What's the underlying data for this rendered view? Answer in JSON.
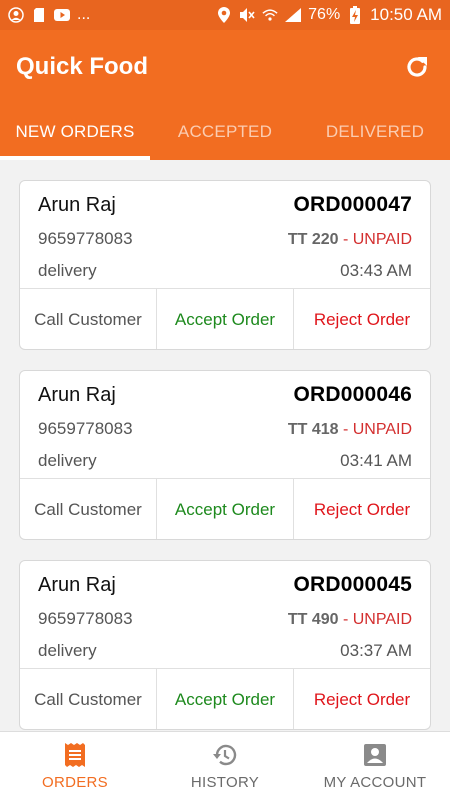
{
  "status_bar": {
    "left_icons": [
      "account-circle-icon",
      "sd-card-icon",
      "youtube-icon"
    ],
    "ellipsis": "...",
    "battery": "76%",
    "time": "10:50 AM"
  },
  "header": {
    "title": "Quick Food",
    "refresh_icon": "refresh-icon"
  },
  "tabs": [
    {
      "label": "NEW ORDERS",
      "active": true
    },
    {
      "label": "ACCEPTED",
      "active": false
    },
    {
      "label": "DELIVERED",
      "active": false
    }
  ],
  "orders": [
    {
      "customer": "Arun Raj",
      "order_id": "ORD000047",
      "phone": "9659778083",
      "amount": "TT 220",
      "separator": " - ",
      "payment_status": "UNPAID",
      "type": "delivery",
      "time": "03:43 AM"
    },
    {
      "customer": "Arun Raj",
      "order_id": "ORD000046",
      "phone": "9659778083",
      "amount": "TT 418",
      "separator": " - ",
      "payment_status": "UNPAID",
      "type": "delivery",
      "time": "03:41 AM"
    },
    {
      "customer": "Arun Raj",
      "order_id": "ORD000045",
      "phone": "9659778083",
      "amount": "TT 490",
      "separator": " - ",
      "payment_status": "UNPAID",
      "type": "delivery",
      "time": "03:37 AM"
    }
  ],
  "actions": {
    "call": "Call Customer",
    "accept": "Accept Order",
    "reject": "Reject Order"
  },
  "bottom_nav": [
    {
      "label": "ORDERS",
      "icon": "receipt-icon",
      "active": true
    },
    {
      "label": "HISTORY",
      "icon": "history-icon",
      "active": false
    },
    {
      "label": "MY ACCOUNT",
      "icon": "account-box-icon",
      "active": false
    }
  ],
  "colors": {
    "primary": "#f26d21",
    "accept": "#1e8a1e",
    "reject": "#e0151b",
    "unpaid": "#d32f2f"
  }
}
